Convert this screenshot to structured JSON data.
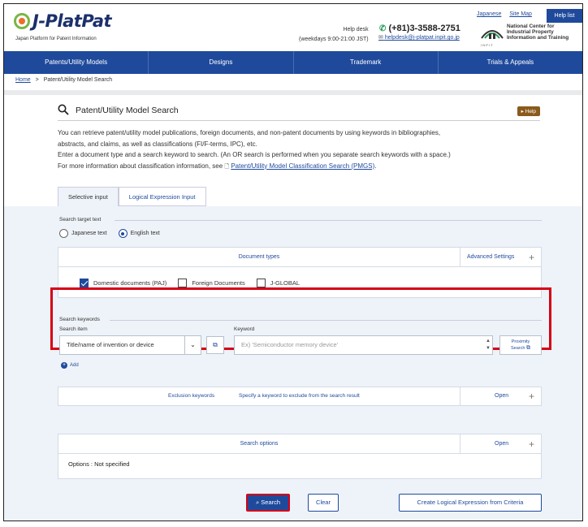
{
  "header": {
    "logo_text": "J-PlatPat",
    "logo_sub": "Japan Platform for Patent Information",
    "helpdesk_label": "Help desk",
    "helpdesk_hours": "(weekdays 9:00-21:00 JST)",
    "phone": "(+81)3-3588-2751",
    "email": "helpdesk@j-platpat.inpit.go.jp",
    "link_japanese": "Japanese",
    "link_sitemap": "Site Map",
    "help_list": "Help list",
    "inpit_line1": "National Center for",
    "inpit_line2": "Industrial Property",
    "inpit_line3": "Information and Training",
    "inpit_caption": "I N P I T"
  },
  "nav": {
    "items": [
      "Patents/Utility Models",
      "Designs",
      "Trademark",
      "Trials & Appeals"
    ]
  },
  "breadcrumb": {
    "home": "Home",
    "separator": ">",
    "current": "Patent/Utility Model Search"
  },
  "page": {
    "title": "Patent/Utility Model Search",
    "help": "▸ Help",
    "desc_line1": "You can retrieve patent/utility model publications, foreign documents, and non-patent documents by using keywords in bibliographies,",
    "desc_line2": "abstracts, and claims, as well as classifications (FI/F-terms, IPC), etc.",
    "desc_line3": "Enter a document type and a search keyword to search. (An OR search is performed when you separate search keywords with a space.)",
    "desc_line4_pre": "For more information about classification information, see",
    "desc_link": "Patent/Utility Model Classification Search (PMGS)",
    "desc_line4_post": "."
  },
  "tabs": [
    "Selective input",
    "Logical Expression Input"
  ],
  "target": {
    "label": "Search target text",
    "options": [
      "Japanese text",
      "English text"
    ],
    "selected": "English text"
  },
  "doc_types": {
    "header": "Document types",
    "advanced": "Advanced Settings",
    "items": [
      {
        "label": "Domestic documents (PAJ)",
        "checked": true
      },
      {
        "label": "Foreign Documents",
        "checked": false
      },
      {
        "label": "J-GLOBAL",
        "checked": false
      }
    ]
  },
  "keywords": {
    "section": "Search keywords",
    "item_label": "Search item",
    "keyword_label": "Keyword",
    "select_value": "Title/name of invention or device",
    "placeholder": "Ex) 'Semiconductor memory device'",
    "proximity_line1": "Proximity",
    "proximity_line2": "Search",
    "add": "Add"
  },
  "exclusion": {
    "title": "Exclusion keywords",
    "hint": "Specify a keyword to exclude from the search result",
    "open": "Open"
  },
  "options": {
    "title": "Search options",
    "open": "Open",
    "value": "Options : Not specified"
  },
  "buttons": {
    "search": "Search",
    "clear": "Clear",
    "create_logical": "Create Logical Expression from Criteria"
  },
  "colors": {
    "nav": "#1f4a9c",
    "highlight": "#d60016",
    "panel": "#eef3f9"
  }
}
